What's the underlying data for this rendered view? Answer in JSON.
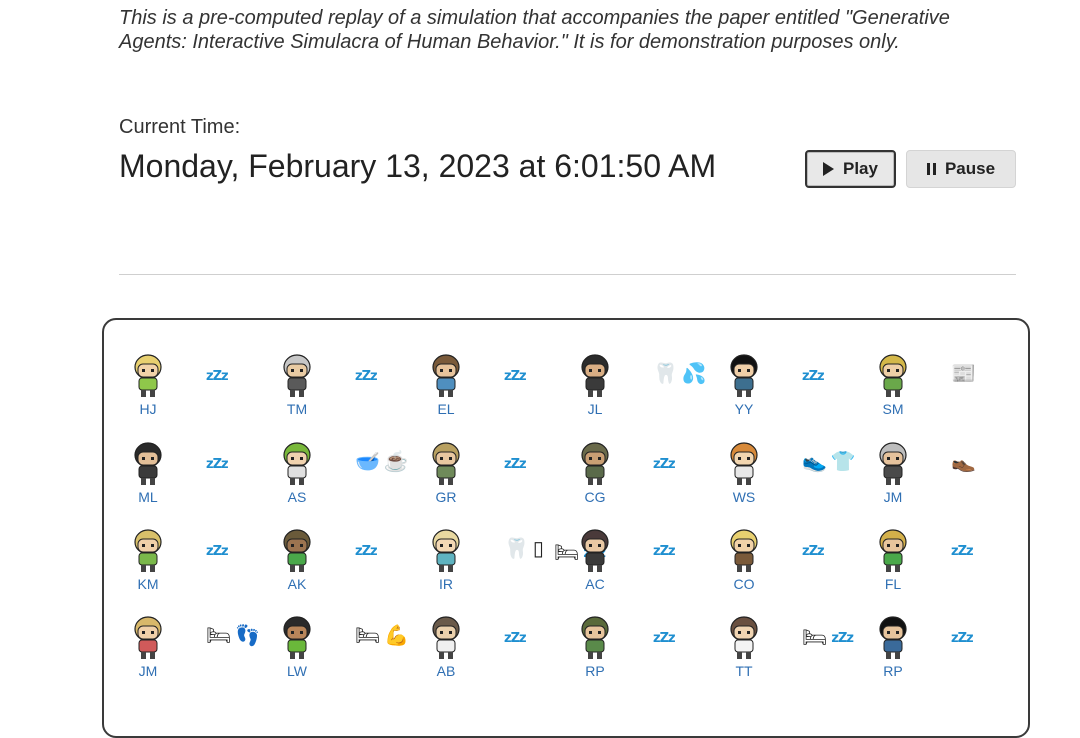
{
  "intro": "This is a pre-computed replay of a simulation that accompanies the paper entitled \"Generative Agents: Interactive Simulacra of Human Behavior.\" It is for demonstration purposes only.",
  "current_time_label": "Current Time:",
  "current_time_value": "Monday, February 13, 2023 at 6:01:50 AM",
  "buttons": {
    "play": "Play",
    "pause": "Pause"
  },
  "colors": {
    "label_blue": "#2f6fb3",
    "panel_border": "#3a3a3a",
    "button_bg": "#e8e8e8"
  },
  "agents": [
    {
      "initials": "HJ",
      "hair": "#e8d070",
      "skin": "#f1d2a8",
      "shirt": "#8fc84a",
      "status": [
        "zzz-icon"
      ]
    },
    {
      "initials": "TM",
      "hair": "#c7c7c7",
      "skin": "#e9cba3",
      "shirt": "#5a5a5a",
      "status": [
        "zzz-icon"
      ]
    },
    {
      "initials": "EL",
      "hair": "#7a5a3a",
      "skin": "#e7c39b",
      "shirt": "#4f8fbf",
      "status": [
        "zzz-icon"
      ]
    },
    {
      "initials": "JL",
      "hair": "#2b2b2b",
      "skin": "#d9ae84",
      "shirt": "#3a3a3a",
      "status": [
        "tooth-icon",
        "sweat-drops-icon"
      ]
    },
    {
      "initials": "YY",
      "hair": "#111111",
      "skin": "#f0cfa8",
      "shirt": "#3d6f8f",
      "status": [
        "zzz-icon"
      ]
    },
    {
      "initials": "SM",
      "hair": "#d4b84a",
      "skin": "#efcfa6",
      "shirt": "#6aa84a",
      "status": [
        "newspaper-icon"
      ]
    },
    {
      "initials": "ML",
      "hair": "#2a2a2a",
      "skin": "#e3bf98",
      "shirt": "#3b3b3b",
      "status": [
        "zzz-icon"
      ]
    },
    {
      "initials": "AS",
      "hair": "#79b83a",
      "skin": "#f0d2ae",
      "shirt": "#e0e0e0",
      "status": [
        "soup-bowl-icon",
        "coffee-icon"
      ]
    },
    {
      "initials": "GR",
      "hair": "#b8a060",
      "skin": "#e8c7a0",
      "shirt": "#6f8a5a",
      "status": [
        "zzz-icon"
      ]
    },
    {
      "initials": "CG",
      "hair": "#6a6a4a",
      "skin": "#c99f74",
      "shirt": "#5a6a4a",
      "status": [
        "zzz-icon"
      ]
    },
    {
      "initials": "WS",
      "hair": "#d88a3a",
      "skin": "#f2d6b0",
      "shirt": "#e8e8e8",
      "status": [
        "sneaker-icon",
        "tshirt-icon"
      ]
    },
    {
      "initials": "JM",
      "hair": "#bdbdbd",
      "skin": "#e5c29c",
      "shirt": "#4a4a4a",
      "status": [
        "shoe-icon"
      ]
    },
    {
      "initials": "KM",
      "hair": "#d8c06a",
      "skin": "#f0d0a8",
      "shirt": "#7ab84a",
      "status": [
        "zzz-icon"
      ]
    },
    {
      "initials": "AK",
      "hair": "#6a5a3a",
      "skin": "#9c7450",
      "shirt": "#4aa84a",
      "status": [
        "zzz-icon"
      ]
    },
    {
      "initials": "IR",
      "hair": "#e8d8a0",
      "skin": "#f3d8b4",
      "shirt": "#5fb3c0",
      "status": [
        "tooth-icon",
        "empty-box-icon"
      ]
    },
    {
      "initials": "",
      "hair": "",
      "skin": "",
      "shirt": "",
      "status": [
        "bed-icon",
        "zzz-icon"
      ],
      "status_only": true
    },
    {
      "initials": "AC",
      "hair": "#4a3a3a",
      "skin": "#e9c8a4",
      "shirt": "#3a3a3a",
      "status": [
        "zzz-icon"
      ]
    },
    {
      "initials": "CO",
      "hair": "#e8d070",
      "skin": "#f1d2a8",
      "shirt": "#7a5a3a",
      "status": [
        "zzz-icon"
      ]
    },
    {
      "initials": "FL",
      "hair": "#d4b04a",
      "skin": "#e7c59c",
      "shirt": "#4aa84a",
      "status": [
        "zzz-icon"
      ]
    },
    {
      "initials": "JM",
      "hair": "#d8b86a",
      "skin": "#f0d0a8",
      "shirt": "#d05a5a",
      "status": [
        "bed-icon",
        "footprints-icon"
      ]
    },
    {
      "initials": "LW",
      "hair": "#2a2a2a",
      "skin": "#b8855a",
      "shirt": "#6ab83a",
      "status": [
        "bed-icon",
        "flexed-arm-icon"
      ]
    },
    {
      "initials": "AB",
      "hair": "#6a5a4a",
      "skin": "#ead0ac",
      "shirt": "#f0f0f0",
      "status": [
        "zzz-icon"
      ]
    },
    {
      "initials": "RP",
      "hair": "#5a6a3a",
      "skin": "#e7c49c",
      "shirt": "#5a8a4a",
      "status": [
        "zzz-icon"
      ]
    },
    {
      "initials": "TT",
      "hair": "#6a5040",
      "skin": "#f0d4b2",
      "shirt": "#f4f4f4",
      "status": [
        "bed-icon",
        "zzz-icon"
      ]
    },
    {
      "initials": "RP",
      "hair": "#111111",
      "skin": "#e7c49c",
      "shirt": "#3a6a9a",
      "status": [
        "zzz-icon"
      ]
    }
  ]
}
